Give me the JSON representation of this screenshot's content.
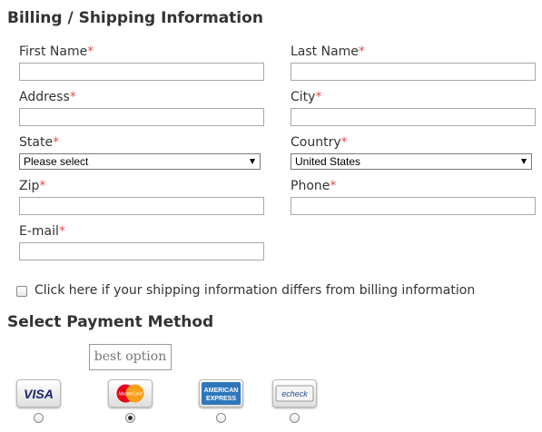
{
  "billing": {
    "title": "Billing / Shipping Information",
    "required_marker": "*",
    "first_name": {
      "label": "First Name",
      "value": ""
    },
    "last_name": {
      "label": "Last Name",
      "value": ""
    },
    "address": {
      "label": "Address",
      "value": ""
    },
    "city": {
      "label": "City",
      "value": ""
    },
    "state": {
      "label": "State",
      "selected": "Please select"
    },
    "country": {
      "label": "Country",
      "selected": "United States"
    },
    "zip": {
      "label": "Zip",
      "value": ""
    },
    "phone": {
      "label": "Phone",
      "value": ""
    },
    "email": {
      "label": "E-mail",
      "value": ""
    },
    "shipping_differs": {
      "label": "Click here if your shipping information differs from billing information",
      "checked": false
    }
  },
  "payment": {
    "title": "Select Payment Method",
    "best_option_label": "best option",
    "methods": [
      {
        "id": "visa",
        "label": "VISA",
        "icon": "visa-card-icon",
        "selected": false
      },
      {
        "id": "mastercard",
        "label": "MasterCard",
        "icon": "mastercard-icon",
        "selected": true
      },
      {
        "id": "amex",
        "label_line1": "AMERICAN",
        "label_line2": "EXPRESS",
        "icon": "amex-card-icon",
        "selected": false
      },
      {
        "id": "echeck",
        "label": "echeck",
        "icon": "echeck-icon",
        "selected": false
      }
    ]
  },
  "colors": {
    "required": "#d9534f",
    "text": "#333333",
    "visa_blue": "#1a1f71",
    "mastercard_red": "#eb001b",
    "mastercard_orange": "#f79e1b",
    "amex_blue": "#2e77bb"
  }
}
